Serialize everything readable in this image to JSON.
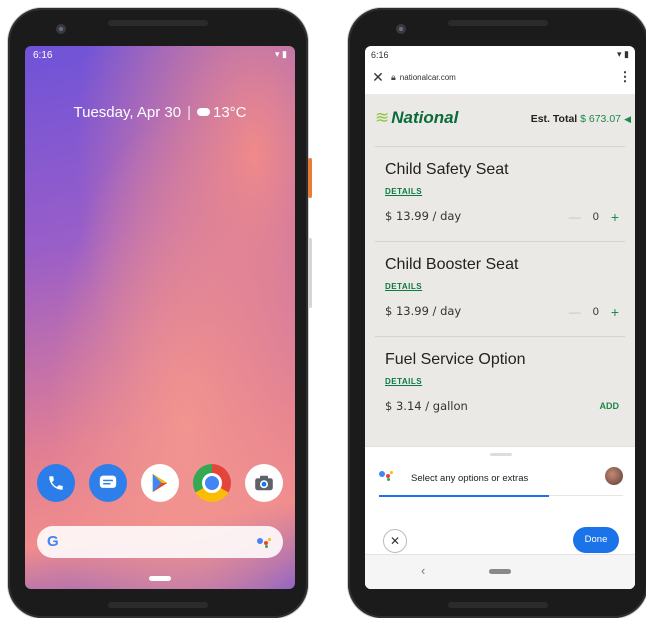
{
  "left_phone": {
    "status_time": "6:16",
    "date_text": "Tuesday, Apr 30",
    "temperature": "13°C",
    "dock_apps": [
      "phone-app-icon",
      "messages-app-icon",
      "play-store-icon",
      "chrome-icon",
      "camera-icon"
    ],
    "search_logo": "G"
  },
  "right_phone": {
    "status_time": "6:16",
    "url": "nationalcar.com",
    "brand": "National",
    "est_label": "Est. Total",
    "est_amount": "$ 673.07",
    "items": [
      {
        "name": "Child Safety Seat",
        "details": "DETAILS",
        "price": "$ 13.99 / day",
        "qty": "0"
      },
      {
        "name": "Child Booster Seat",
        "details": "DETAILS",
        "price": "$ 13.99 / day",
        "qty": "0"
      },
      {
        "name": "Fuel Service Option",
        "details": "DETAILS",
        "price": "$ 3.14 / gallon",
        "action": "ADD"
      }
    ],
    "assistant_prompt": "Select any options or extras",
    "done_label": "Done",
    "colors": {
      "brand_green": "#0b6b3a",
      "accent_blue": "#1a73e8"
    }
  }
}
